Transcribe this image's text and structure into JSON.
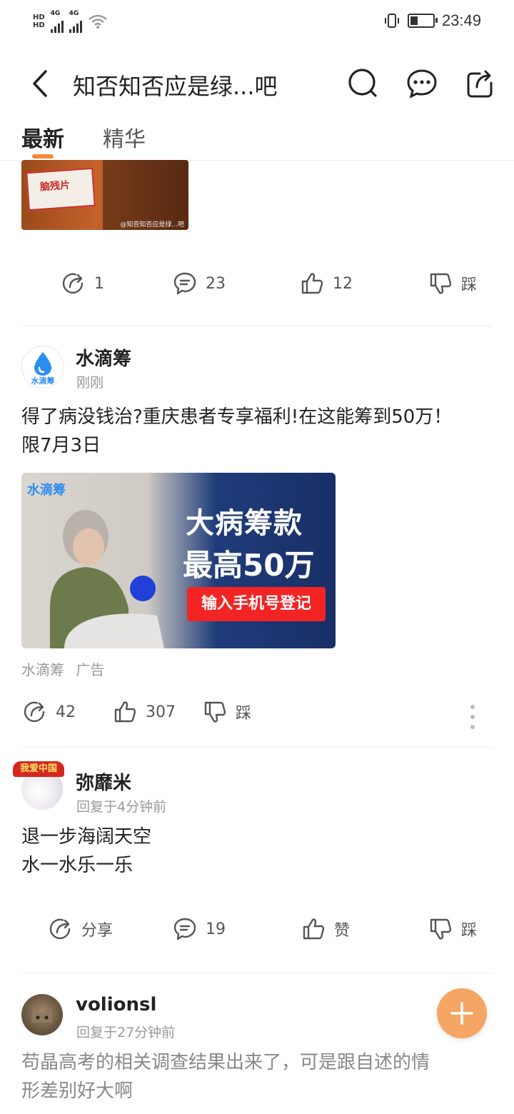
{
  "status": {
    "hd1": "HD",
    "hd2": "HD",
    "net1": "4G",
    "net2": "4G",
    "time": "23:49"
  },
  "header": {
    "title": "知否知否应是绿...吧",
    "icons": [
      "back-icon",
      "search-icon",
      "more-icon",
      "share-icon"
    ]
  },
  "tabs": {
    "latest": "最新",
    "featured": "精华"
  },
  "post1": {
    "thumb_text": "脑残片",
    "watermark": "@知否知否应是绿...吧",
    "share_count": "1",
    "comment_count": "23",
    "like_count": "12",
    "dislike_label": "踩"
  },
  "ad": {
    "author": "水滴筹",
    "time": "刚刚",
    "avatar_text": "水滴筹",
    "text_line1": "得了病没钱治?重庆患者专享福利!在这能筹到50万！",
    "text_line2": "限7月3日",
    "image_logo": "水滴筹",
    "headline1": "大病筹款",
    "headline2": "最高50万",
    "cta": "输入手机号登记",
    "source": "水滴筹",
    "tag": "广告",
    "share_count": "42",
    "like_count": "307",
    "dislike_label": "踩"
  },
  "post2": {
    "author": "弥靡米",
    "time": "回复于4分钟前",
    "badge": "我爱中国",
    "line1": "退一步海阔天空",
    "line2": "水一水乐一乐",
    "share_label": "分享",
    "comment_count": "19",
    "like_label": "赞",
    "dislike_label": "踩"
  },
  "post3": {
    "author": "volionsl",
    "time": "回复于27分钟前",
    "line1": "苟晶高考的相关调查结果出来了，可是跟自述的情",
    "line2": "形差别好大啊"
  },
  "colors": {
    "accent": "#f08a3c",
    "fab": "#f5a664",
    "ad_button": "#f32424"
  }
}
